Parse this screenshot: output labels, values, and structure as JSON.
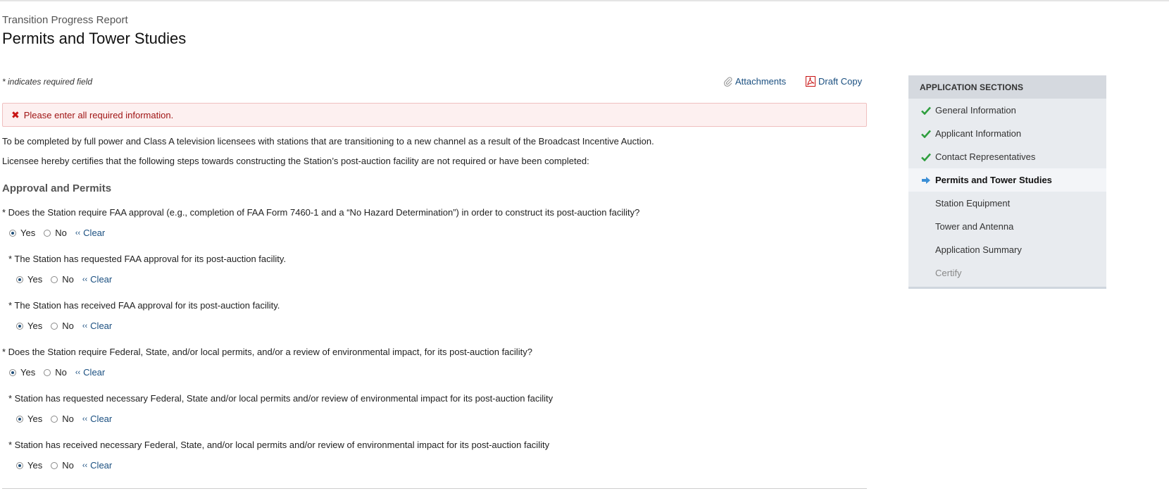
{
  "page": {
    "pretitle": "Transition Progress Report",
    "title": "Permits and Tower Studies"
  },
  "toolbar": {
    "required_note": "* indicates required field",
    "attachments_label": "Attachments",
    "draft_copy_label": "Draft Copy"
  },
  "error": {
    "message": "Please enter all required information."
  },
  "intro": {
    "line1": "To be completed by full power and Class A television licensees with stations that are transitioning to a new channel as a result of the Broadcast Incentive Auction.",
    "line2": "Licensee hereby certifies that the following steps towards constructing the Station’s post-auction facility are not required or have been completed:"
  },
  "section": {
    "heading": "Approval and Permits"
  },
  "radio_labels": {
    "yes": "Yes",
    "no": "No",
    "clear": "Clear"
  },
  "questions": [
    {
      "text": "* Does the Station require FAA approval (e.g., completion of FAA Form 7460-1 and a “No Hazard Determination”) in order to construct its post-auction facility?",
      "selected": "Yes"
    },
    {
      "text": "* The Station has requested FAA approval for its post-auction facility.",
      "selected": "Yes"
    },
    {
      "text": "* The Station has received FAA approval for its post-auction facility.",
      "selected": "Yes"
    },
    {
      "text": "* Does the Station require Federal, State, and/or local permits, and/or a review of environmental impact, for its post-auction facility?",
      "selected": "Yes"
    },
    {
      "text": "* Station has requested necessary Federal, State and/or local permits and/or review of environmental impact for its post-auction facility",
      "selected": "Yes"
    },
    {
      "text": "* Station has received necessary Federal, State, and/or local permits and/or review of environmental impact for its post-auction facility",
      "selected": "Yes"
    }
  ],
  "sidebar": {
    "header": "APPLICATION SECTIONS",
    "items": [
      {
        "label": "General Information",
        "status": "complete"
      },
      {
        "label": "Applicant Information",
        "status": "complete"
      },
      {
        "label": "Contact Representatives",
        "status": "complete"
      },
      {
        "label": "Permits and Tower Studies",
        "status": "current"
      },
      {
        "label": "Station Equipment",
        "status": "pending"
      },
      {
        "label": "Tower and Antenna",
        "status": "pending"
      },
      {
        "label": "Application Summary",
        "status": "pending"
      },
      {
        "label": "Certify",
        "status": "disabled"
      }
    ]
  },
  "colors": {
    "link": "#1a4f80",
    "error_text": "#a01515",
    "error_bg": "#fdf0f0",
    "check_green": "#2e9e3e",
    "current_arrow": "#3b8fd6"
  }
}
